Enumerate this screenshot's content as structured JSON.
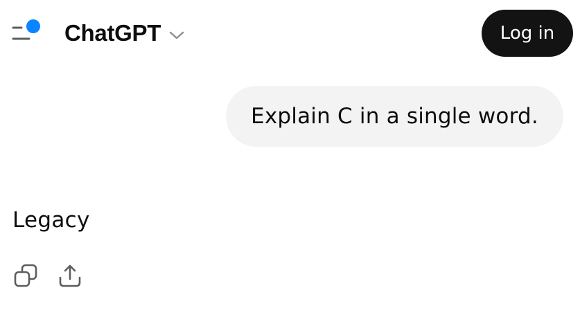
{
  "header": {
    "model_name": "ChatGPT",
    "login_label": "Log in",
    "menu_icon": "sidebar-menu-icon",
    "notification_dot_color": "#0a84ff",
    "chevron_icon": "chevron-down-icon"
  },
  "conversation": {
    "user_message": "Explain C in a single word.",
    "assistant_reply": "Legacy"
  },
  "actions": {
    "copy_icon": "copy-icon",
    "share_icon": "share-icon"
  },
  "colors": {
    "login_bg": "#131313",
    "bubble_bg": "#f3f3f3",
    "text": "#0d0d0d"
  }
}
